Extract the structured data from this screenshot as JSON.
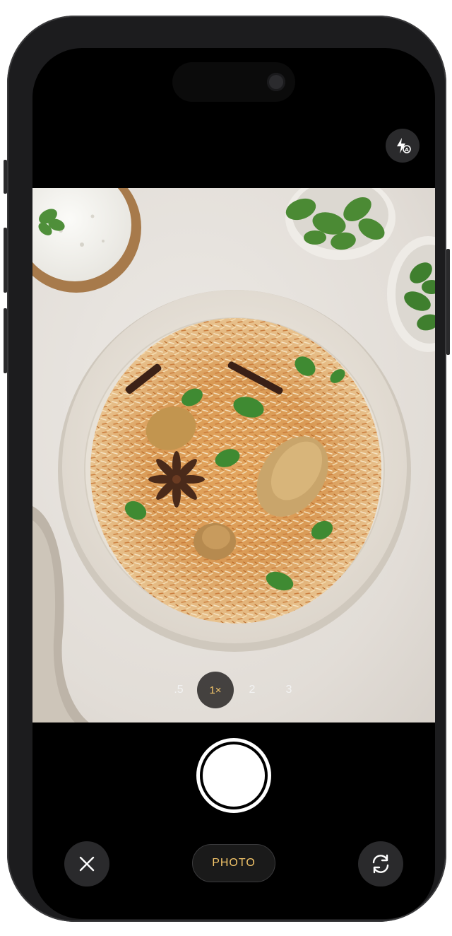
{
  "camera": {
    "flash_icon": "flash-auto-icon",
    "zoom_options": [
      ".5",
      "1×",
      "2",
      "3"
    ],
    "zoom_selected": "1×",
    "mode_label": "PHOTO",
    "close_icon": "close-icon",
    "switch_camera_icon": "switch-camera-icon",
    "shutter_icon": "shutter-button",
    "accent_color": "#f4c66a"
  },
  "viewfinder": {
    "subject": "biryani-with-raita-and-cilantro"
  }
}
